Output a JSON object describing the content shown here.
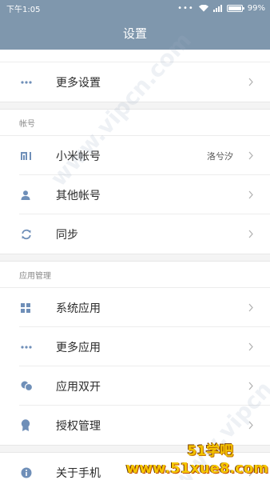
{
  "status_bar": {
    "time": "下午1:05",
    "dots": "•••",
    "battery": "99%",
    "battery_level": 0.99
  },
  "header": {
    "title": "设置"
  },
  "top_group": {
    "items": [
      {
        "label": "更多设置",
        "icon": "more-icon"
      }
    ]
  },
  "account": {
    "section_title": "帐号",
    "items": [
      {
        "label": "小米帐号",
        "value": "洛兮汐",
        "icon": "mi-icon"
      },
      {
        "label": "其他帐号",
        "icon": "person-icon"
      },
      {
        "label": "同步",
        "icon": "sync-icon"
      }
    ]
  },
  "apps": {
    "section_title": "应用管理",
    "items": [
      {
        "label": "系统应用",
        "icon": "grid-icon"
      },
      {
        "label": "更多应用",
        "icon": "more-icon"
      },
      {
        "label": "应用双开",
        "icon": "dual-app-icon"
      },
      {
        "label": "授权管理",
        "icon": "authorization-icon"
      }
    ]
  },
  "about": {
    "items": [
      {
        "label": "关于手机",
        "icon": "info-icon"
      }
    ]
  },
  "watermarks": {
    "vipcn_1": "www.vipcn.com",
    "vipcn_2": "www.vipcn.com",
    "brand_line1": "51学吧",
    "brand_line2": "www.51xue8.com"
  },
  "colors": {
    "header_bg": "#7f97ad",
    "icon": "#6f8fb8"
  }
}
